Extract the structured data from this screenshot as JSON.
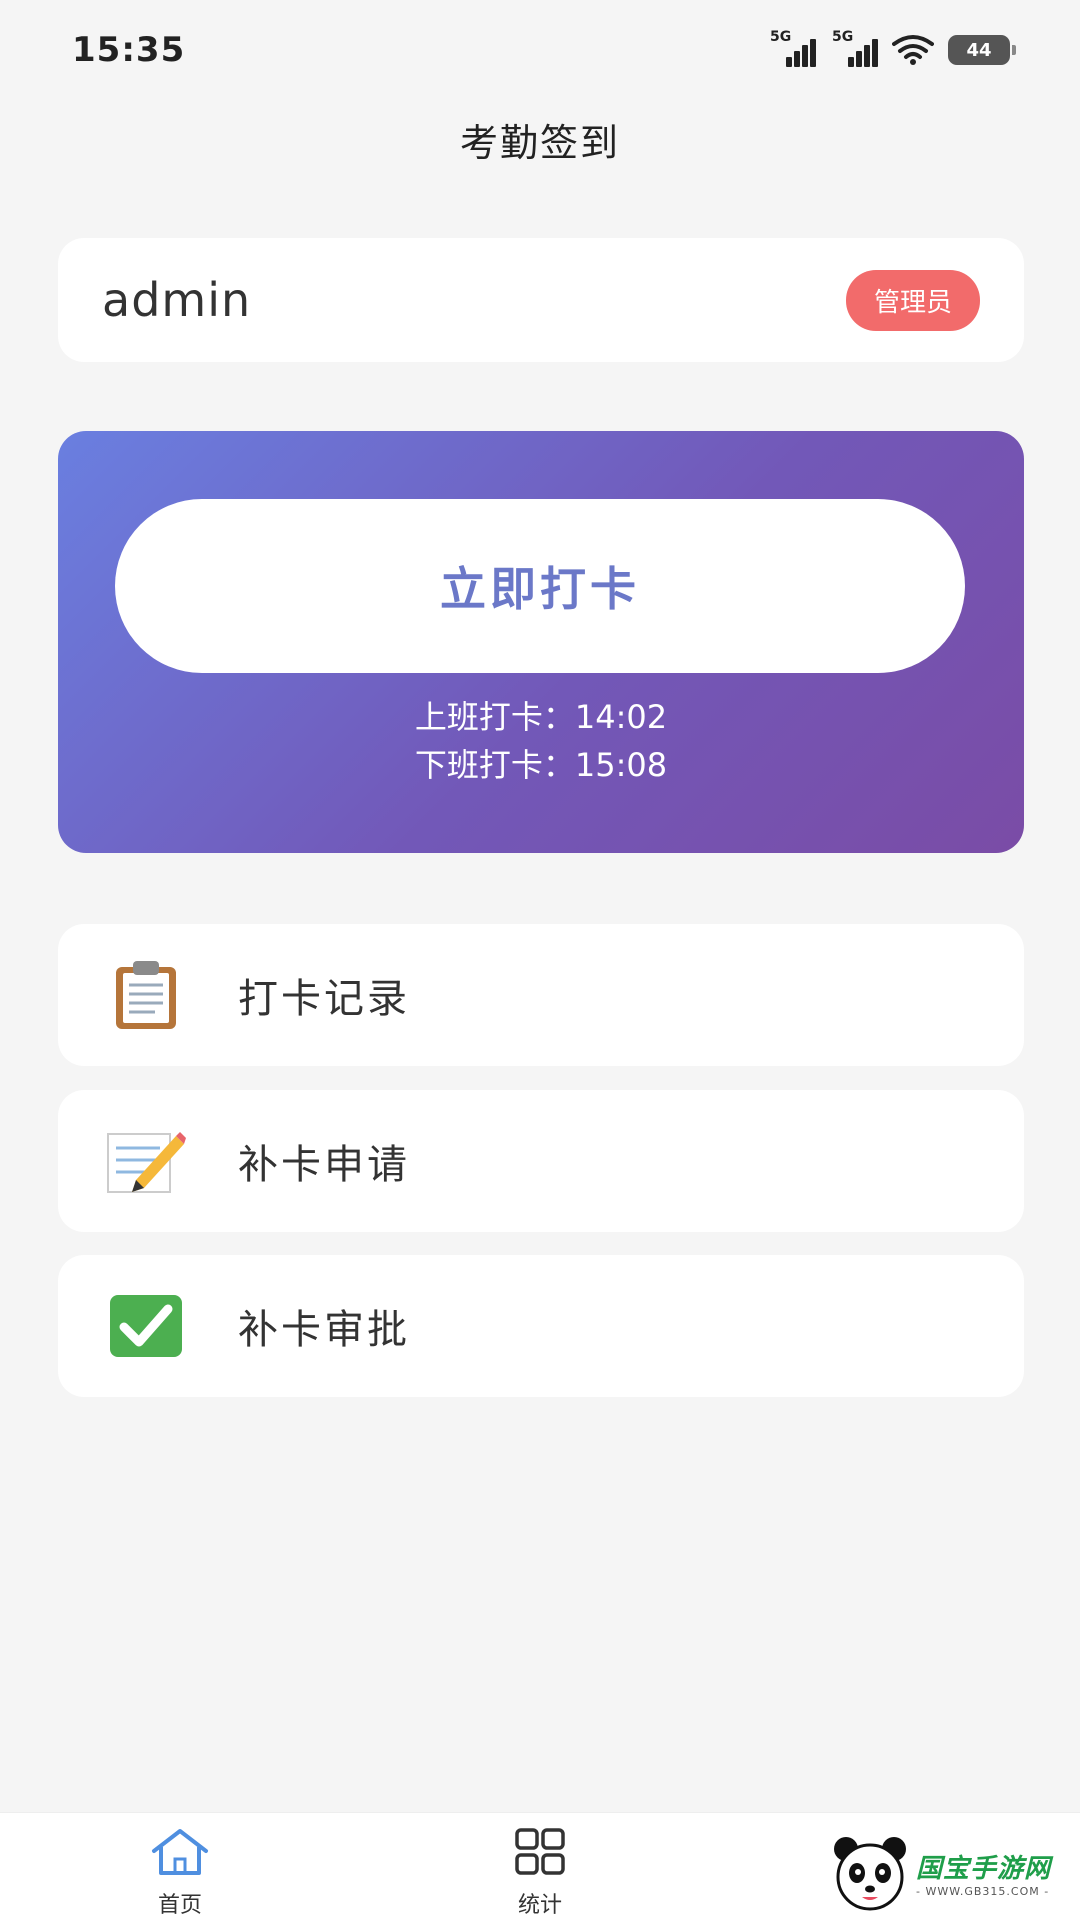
{
  "status_bar": {
    "time": "15:35",
    "sim1_label": "5G",
    "sim2_label": "5G",
    "battery_level": "44"
  },
  "header": {
    "title": "考勤签到"
  },
  "user": {
    "name": "admin",
    "role": "管理员",
    "role_color": "#f26b6b"
  },
  "checkin": {
    "button_label": "立即打卡",
    "clock_in": "上班打卡：14:02",
    "clock_out": "下班打卡：15:08",
    "gradient_start": "#6a7fe0",
    "gradient_end": "#7a4ca6"
  },
  "menu": {
    "items": [
      {
        "label": "打卡记录",
        "icon": "clipboard-icon"
      },
      {
        "label": "补卡申请",
        "icon": "memo-pencil-icon"
      },
      {
        "label": "补卡审批",
        "icon": "check-mark-icon"
      }
    ]
  },
  "tabbar": {
    "home_label": "首页",
    "stats_label": "统计",
    "active_color": "#4f8fe0"
  },
  "watermark": {
    "name": "国宝手游网",
    "url": "- WWW.GB315.COM -"
  }
}
